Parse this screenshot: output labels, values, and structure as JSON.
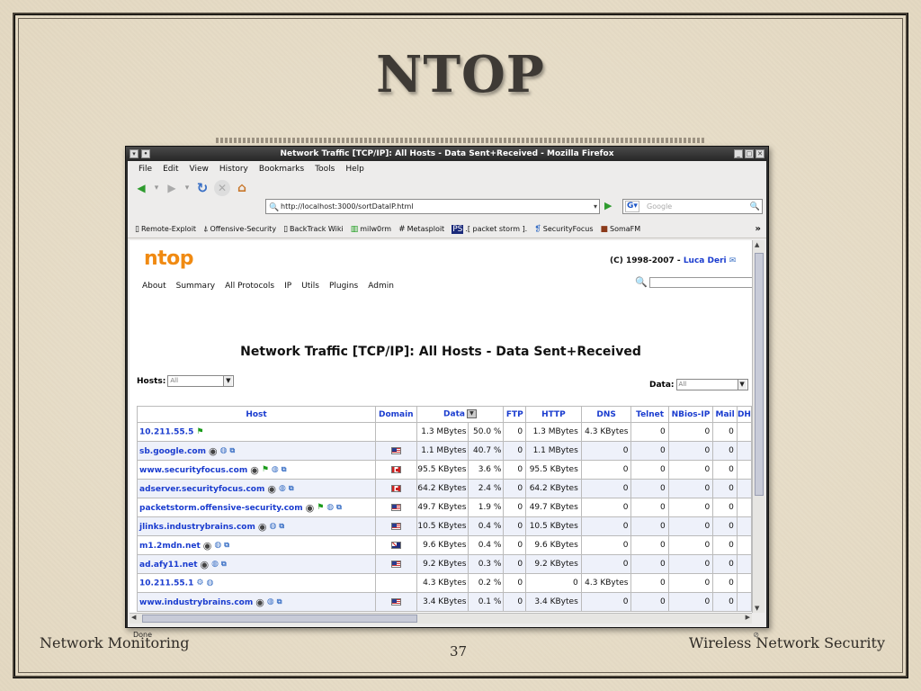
{
  "slide": {
    "title": "NTOP",
    "footer_left": "Network Monitoring",
    "footer_right": "Wireless Network Security",
    "page_number": "37"
  },
  "window": {
    "title": "Network Traffic [TCP/IP]: All Hosts - Data Sent+Received - Mozilla Firefox",
    "menu": [
      "File",
      "Edit",
      "View",
      "History",
      "Bookmarks",
      "Tools",
      "Help"
    ],
    "url": "http://localhost:3000/sortDataIP.html",
    "search_placeholder": "Google",
    "bookmarks": [
      "Remote-Exploit",
      "Offensive-Security",
      "BackTrack Wiki",
      "milw0rm",
      "Metasploit",
      ".[ packet storm ].",
      "SecurityFocus",
      "SomaFM"
    ],
    "bookmarks_more": "»",
    "status": "Done"
  },
  "ntop": {
    "logo": "ntop",
    "copyright_prefix": "(C) 1998-2007 - ",
    "author": "Luca Deri",
    "menu": [
      "About",
      "Summary",
      "All Protocols",
      "IP",
      "Utils",
      "Plugins",
      "Admin"
    ],
    "heading": "Network Traffic [TCP/IP]: All Hosts - Data Sent+Received",
    "hosts_label": "Hosts:",
    "hosts_value": "All",
    "data_label": "Data:",
    "data_value": "All"
  },
  "table": {
    "columns": [
      "Host",
      "Domain",
      "Data",
      "FTP",
      "HTTP",
      "DNS",
      "Telnet",
      "NBios-IP",
      "Mail",
      "DH"
    ],
    "rows": [
      {
        "host": "10.211.55.5",
        "flag": "",
        "icons": [
          "green"
        ],
        "data": "1.3 MBytes",
        "pct": "50.0 %",
        "ftp": "0",
        "http": "1.3 MBytes",
        "dns": "4.3 KBytes",
        "telnet": "0",
        "nbios": "0",
        "mail": "0"
      },
      {
        "host": "sb.google.com",
        "flag": "us",
        "icons": [
          "os",
          "globe",
          "link"
        ],
        "data": "1.1 MBytes",
        "pct": "40.7 %",
        "ftp": "0",
        "http": "1.1 MBytes",
        "dns": "0",
        "telnet": "0",
        "nbios": "0",
        "mail": "0"
      },
      {
        "host": "www.securityfocus.com",
        "flag": "ca",
        "icons": [
          "os",
          "green",
          "globe",
          "link"
        ],
        "data": "95.5 KBytes",
        "pct": "3.6 %",
        "ftp": "0",
        "http": "95.5 KBytes",
        "dns": "0",
        "telnet": "0",
        "nbios": "0",
        "mail": "0"
      },
      {
        "host": "adserver.securityfocus.com",
        "flag": "ca",
        "icons": [
          "os",
          "globe",
          "link"
        ],
        "data": "64.2 KBytes",
        "pct": "2.4 %",
        "ftp": "0",
        "http": "64.2 KBytes",
        "dns": "0",
        "telnet": "0",
        "nbios": "0",
        "mail": "0"
      },
      {
        "host": "packetstorm.offensive-security.com",
        "flag": "us",
        "icons": [
          "os",
          "green",
          "globe",
          "link"
        ],
        "data": "49.7 KBytes",
        "pct": "1.9 %",
        "ftp": "0",
        "http": "49.7 KBytes",
        "dns": "0",
        "telnet": "0",
        "nbios": "0",
        "mail": "0"
      },
      {
        "host": "jlinks.industrybrains.com",
        "flag": "us",
        "icons": [
          "os",
          "globe",
          "link"
        ],
        "data": "10.5 KBytes",
        "pct": "0.4 %",
        "ftp": "0",
        "http": "10.5 KBytes",
        "dns": "0",
        "telnet": "0",
        "nbios": "0",
        "mail": "0"
      },
      {
        "host": "m1.2mdn.net",
        "flag": "au",
        "icons": [
          "os",
          "globe",
          "link"
        ],
        "data": "9.6 KBytes",
        "pct": "0.4 %",
        "ftp": "0",
        "http": "9.6 KBytes",
        "dns": "0",
        "telnet": "0",
        "nbios": "0",
        "mail": "0"
      },
      {
        "host": "ad.afy11.net",
        "flag": "us",
        "icons": [
          "os",
          "globe",
          "link"
        ],
        "data": "9.2 KBytes",
        "pct": "0.3 %",
        "ftp": "0",
        "http": "9.2 KBytes",
        "dns": "0",
        "telnet": "0",
        "nbios": "0",
        "mail": "0"
      },
      {
        "host": "10.211.55.1",
        "flag": "",
        "icons": [
          "network",
          "globe"
        ],
        "data": "4.3 KBytes",
        "pct": "0.2 %",
        "ftp": "0",
        "http": "0",
        "dns": "4.3 KBytes",
        "telnet": "0",
        "nbios": "0",
        "mail": "0"
      },
      {
        "host": "www.industrybrains.com",
        "flag": "us",
        "icons": [
          "os",
          "globe",
          "link"
        ],
        "data": "3.4 KBytes",
        "pct": "0.1 %",
        "ftp": "0",
        "http": "3.4 KBytes",
        "dns": "0",
        "telnet": "0",
        "nbios": "0",
        "mail": "0"
      }
    ]
  }
}
